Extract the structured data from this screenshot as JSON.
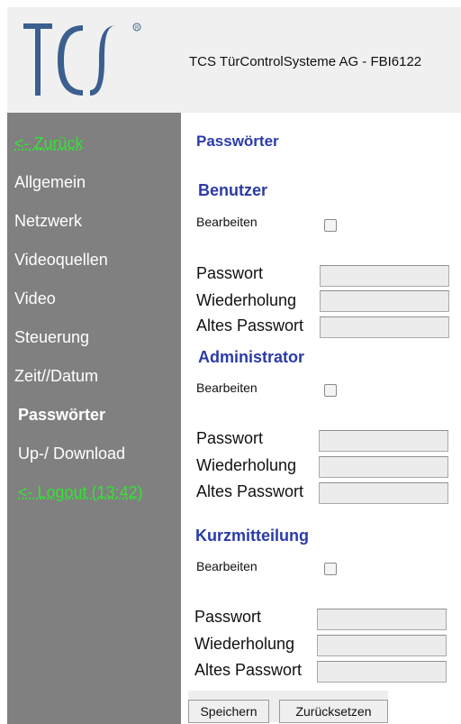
{
  "header": {
    "title": "TCS TürControlSysteme AG - FBI6122",
    "logo_text": "TCS"
  },
  "sidebar": {
    "items": [
      {
        "label": "<- Zurück"
      },
      {
        "label": "Allgemein"
      },
      {
        "label": "Netzwerk"
      },
      {
        "label": "Videoquellen"
      },
      {
        "label": "Video"
      },
      {
        "label": "Steuerung"
      },
      {
        "label": "Zeit//Datum"
      },
      {
        "label": "Passwörter"
      },
      {
        "label": "Up-/ Download"
      },
      {
        "label": "<- Logout (13:42)"
      }
    ]
  },
  "main": {
    "page_title": "Passwörter",
    "sections": [
      {
        "title": "Benutzer",
        "edit_label": "Bearbeiten",
        "fields": [
          {
            "label": "Passwort",
            "value": ""
          },
          {
            "label": "Wiederholung",
            "value": ""
          },
          {
            "label": "Altes Passwort",
            "value": ""
          }
        ]
      },
      {
        "title": "Administrator",
        "edit_label": "Bearbeiten",
        "fields": [
          {
            "label": "Passwort",
            "value": ""
          },
          {
            "label": "Wiederholung",
            "value": ""
          },
          {
            "label": "Altes Passwort",
            "value": ""
          }
        ]
      },
      {
        "title": "Kurzmitteilung",
        "edit_label": "Bearbeiten",
        "fields": [
          {
            "label": "Passwort",
            "value": ""
          },
          {
            "label": "Wiederholung",
            "value": ""
          },
          {
            "label": "Altes Passwort",
            "value": ""
          }
        ]
      }
    ],
    "buttons": {
      "save": "Speichern",
      "reset": "Zurücksetzen"
    }
  },
  "colors": {
    "brand_blue": "#2b3ba8",
    "sidebar_bg": "#808080",
    "link_green": "#33e333"
  }
}
